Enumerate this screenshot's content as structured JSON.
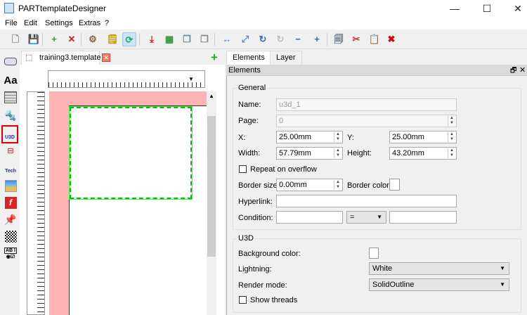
{
  "window": {
    "title": "PARTtemplateDesigner",
    "min": "—",
    "max": "☐",
    "close": "✕"
  },
  "menu": [
    "File",
    "Edit",
    "Settings",
    "Extras",
    "?"
  ],
  "toolbar": [
    "new-icon",
    "save-icon",
    "add-page-icon",
    "delete-page-icon",
    "settings-icon",
    "notes-icon",
    "refresh-icon",
    "export-pdf-icon",
    "export-image-icon",
    "bring-front-icon",
    "send-back-icon",
    "fit-width-icon",
    "fit-page-icon",
    "rotate-icon",
    "rotate-disabled-icon",
    "zoom-out-icon",
    "zoom-in-icon",
    "copy-icon",
    "cut-icon",
    "paste-icon",
    "delete-icon"
  ],
  "palette": [
    "frame-tool",
    "text-tool",
    "table-tool",
    "3d-tool",
    "u3d-tool",
    "cad-tool",
    "tech-tool",
    "image-tool",
    "flash-tool",
    "pin-tool",
    "qrcode-tool",
    "form-tool"
  ],
  "palette_text": {
    "text": "Aa",
    "u3d": "U3D",
    "tech": "Tech",
    "form": "AB I"
  },
  "document_tab": {
    "label": "training3.template"
  },
  "right_tabs": [
    "Elements",
    "Layer"
  ],
  "panel": {
    "title": "Elements",
    "general": {
      "title": "General",
      "name_label": "Name:",
      "name_value": "u3d_1",
      "page_label": "Page:",
      "page_value": "0",
      "x_label": "X:",
      "x_value": "25.00mm",
      "y_label": "Y:",
      "y_value": "25.00mm",
      "width_label": "Width:",
      "width_value": "57.79mm",
      "height_label": "Height:",
      "height_value": "43.20mm",
      "repeat_label": "Repeat on overflow",
      "repeat_checked": false,
      "border_size_label": "Border size:",
      "border_size_value": "0.00mm",
      "border_color_label": "Border color:",
      "border_color": "#ffffff",
      "hyperlink_label": "Hyperlink:",
      "hyperlink_value": "",
      "condition_label": "Condition:",
      "condition_left": "",
      "condition_op": "=",
      "condition_right": ""
    },
    "u3d": {
      "title": "U3D",
      "bg_label": "Background color:",
      "bg_color": "#ffffff",
      "lightning_label": "Lightning:",
      "lightning_value": "White",
      "render_label": "Render mode:",
      "render_value": "SolidOutline",
      "threads_label": "Show threads",
      "threads_checked": false
    }
  },
  "colors": {
    "page_margin": "#ffb3b3",
    "selection": "#00c000",
    "active_tool": "#e00000"
  }
}
